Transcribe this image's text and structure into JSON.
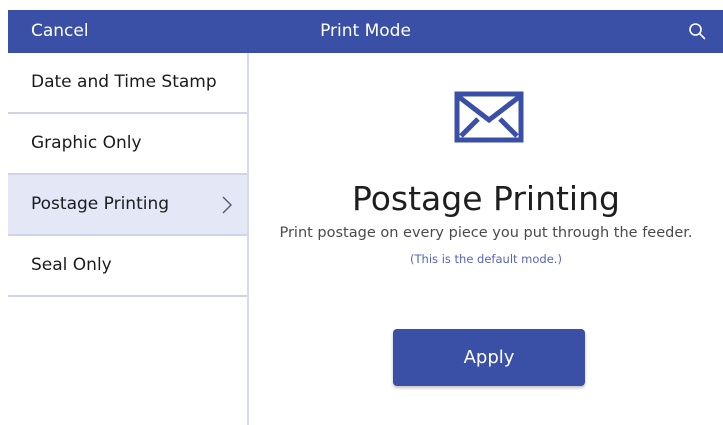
{
  "header": {
    "cancel_label": "Cancel",
    "title": "Print Mode",
    "search_icon": "search-icon"
  },
  "sidebar": {
    "items": [
      {
        "label": "Date and Time Stamp",
        "selected": false
      },
      {
        "label": "Graphic Only",
        "selected": false
      },
      {
        "label": "Postage Printing",
        "selected": true
      },
      {
        "label": "Seal Only",
        "selected": false
      }
    ]
  },
  "main": {
    "icon": "envelope-icon",
    "title": "Postage Printing",
    "description": "Print postage on every piece you put through the feeder.",
    "note": "(This is the default mode.)",
    "apply_label": "Apply"
  },
  "colors": {
    "brand": "#3a4fa6",
    "selected_bg": "#e3e7f6",
    "note_text": "#5566b8"
  }
}
